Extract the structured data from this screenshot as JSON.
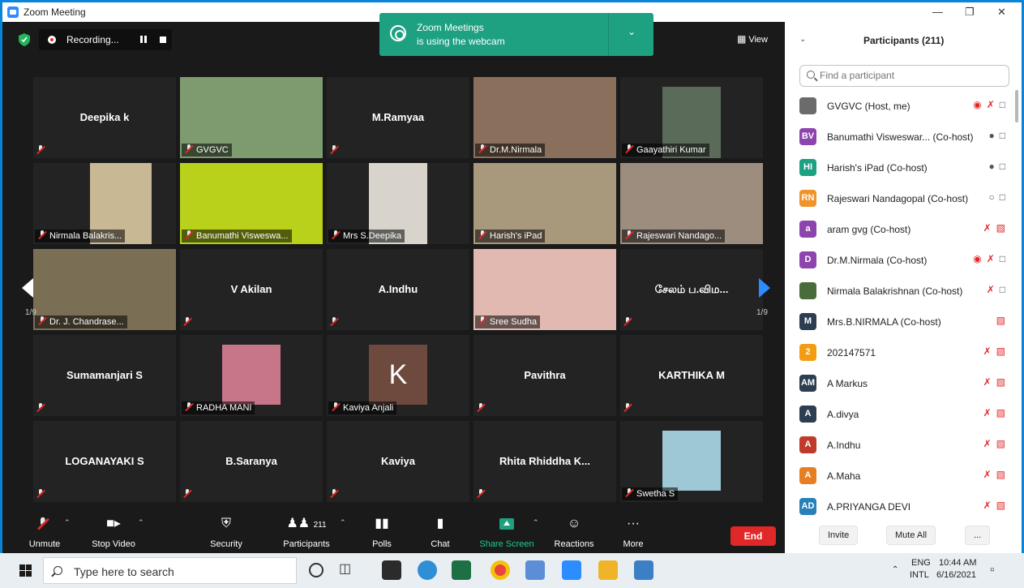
{
  "window": {
    "title": "Zoom Meeting"
  },
  "topbar": {
    "recording_label": "Recording...",
    "view_label": "View"
  },
  "toast": {
    "line1": "Zoom Meetings",
    "line2": "is using the webcam"
  },
  "grid": {
    "page_left": "1/9",
    "page_right": "1/9",
    "tiles": [
      {
        "name": "Deepika k",
        "label": ""
      },
      {
        "name": "",
        "label": "GVGVC"
      },
      {
        "name": "M.Ramyaa",
        "label": ""
      },
      {
        "name": "",
        "label": "Dr.M.Nirmala"
      },
      {
        "name": "",
        "label": "Gaayathiri Kumar"
      },
      {
        "name": "",
        "label": "Nirmala Balakris..."
      },
      {
        "name": "",
        "label": "Banumathi Visweswa..."
      },
      {
        "name": "",
        "label": "Mrs S.Deepika"
      },
      {
        "name": "",
        "label": "Harish's iPad"
      },
      {
        "name": "",
        "label": "Rajeswari Nandago..."
      },
      {
        "name": "",
        "label": "Dr. J. Chandrase..."
      },
      {
        "name": "V Akilan",
        "label": ""
      },
      {
        "name": "A.Indhu",
        "label": ""
      },
      {
        "name": "",
        "label": "Sree Sudha"
      },
      {
        "name": "சேலம் ப.விம...",
        "label": ""
      },
      {
        "name": "Sumamanjari S",
        "label": ""
      },
      {
        "name": "",
        "label": "RADHA MANI"
      },
      {
        "name": "K",
        "label": "Kaviya Anjali"
      },
      {
        "name": "Pavithra",
        "label": ""
      },
      {
        "name": "KARTHIKA M",
        "label": ""
      },
      {
        "name": "LOGANAYAKI S",
        "label": ""
      },
      {
        "name": "B.Saranya",
        "label": ""
      },
      {
        "name": "Kaviya",
        "label": ""
      },
      {
        "name": "Rhita Rhiddha K...",
        "label": ""
      },
      {
        "name": "",
        "label": "Swetha S"
      }
    ]
  },
  "toolbar": {
    "unmute": "Unmute",
    "stop_video": "Stop Video",
    "security": "Security",
    "participants": "Participants",
    "participants_count": "211",
    "polls": "Polls",
    "chat": "Chat",
    "share_screen": "Share Screen",
    "reactions": "Reactions",
    "more": "More",
    "end": "End"
  },
  "panel": {
    "title": "Participants (211)",
    "search_placeholder": "Find a participant",
    "invite": "Invite",
    "mute_all": "Mute All",
    "more": "...",
    "participants": [
      {
        "initials": "",
        "name": "GVGVC (Host, me)",
        "color": "#6b6b6b"
      },
      {
        "initials": "BV",
        "name": "Banumathi Visweswar... (Co-host)",
        "color": "#8e44ad"
      },
      {
        "initials": "HI",
        "name": "Harish's iPad (Co-host)",
        "color": "#1ea181"
      },
      {
        "initials": "RN",
        "name": "Rajeswari Nandagopal (Co-host)",
        "color": "#f0932b"
      },
      {
        "initials": "a",
        "name": "aram gvg (Co-host)",
        "color": "#8e44ad"
      },
      {
        "initials": "D",
        "name": "Dr.M.Nirmala (Co-host)",
        "color": "#8e44ad"
      },
      {
        "initials": "",
        "name": "Nirmala Balakrishnan (Co-host)",
        "color": "#4a6b3a"
      },
      {
        "initials": "M",
        "name": "Mrs.B.NIRMALA (Co-host)",
        "color": "#2c3e50"
      },
      {
        "initials": "2",
        "name": "202147571",
        "color": "#f39c12"
      },
      {
        "initials": "AM",
        "name": "A Markus",
        "color": "#2c3e50"
      },
      {
        "initials": "A",
        "name": "A.divya",
        "color": "#2c3e50"
      },
      {
        "initials": "A",
        "name": "A.Indhu",
        "color": "#c0392b"
      },
      {
        "initials": "A",
        "name": "A.Maha",
        "color": "#e67e22"
      },
      {
        "initials": "AD",
        "name": "A.PRIYANGA DEVI",
        "color": "#2980b9"
      }
    ]
  },
  "taskbar": {
    "search_placeholder": "Type here to search",
    "lang1": "ENG",
    "lang2": "INTL",
    "time": "10:44 AM",
    "date": "6/16/2021"
  }
}
